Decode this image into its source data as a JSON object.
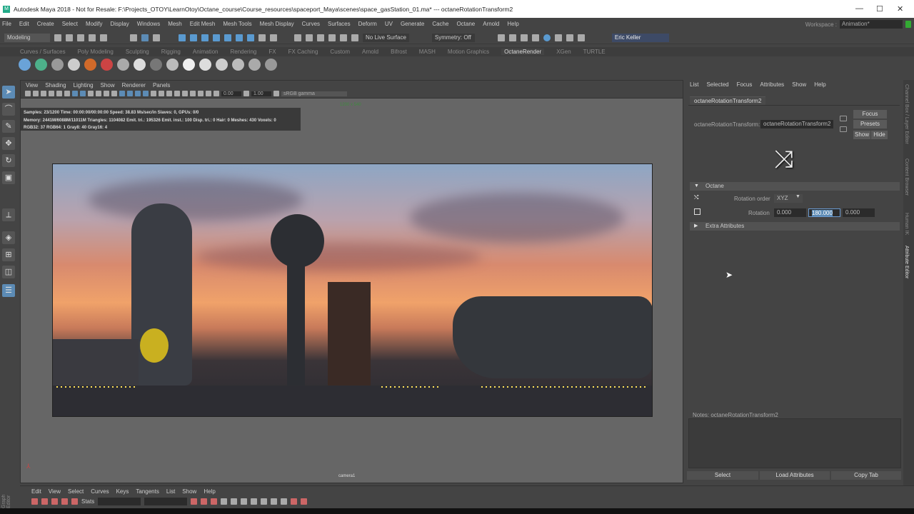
{
  "window": {
    "title": "Autodesk Maya 2018 - Not for Resale: F:\\Projects_OTOY\\LearnOtoy\\Octane_course\\Course_resources\\spaceport_Maya\\scenes\\space_gasStation_01.ma*  ---  octaneRotationTransform2",
    "minimize": "—",
    "maximize": "☐",
    "close": "✕"
  },
  "menubar": [
    "File",
    "Edit",
    "Create",
    "Select",
    "Modify",
    "Display",
    "Windows",
    "Mesh",
    "Edit Mesh",
    "Mesh Tools",
    "Mesh Display",
    "Curves",
    "Surfaces",
    "Deform",
    "UV",
    "Generate",
    "Cache",
    "Octane",
    "Arnold",
    "Help"
  ],
  "workspace": {
    "label": "Workspace :",
    "value": "Animation*"
  },
  "statusline": {
    "mode": "Modeling",
    "live_surface": "No Live Surface",
    "symmetry": "Symmetry: Off",
    "user": "Eric Keller"
  },
  "shelf_tabs": [
    "Curves / Surfaces",
    "Poly Modeling",
    "Sculpting",
    "Rigging",
    "Animation",
    "Rendering",
    "FX",
    "FX Caching",
    "Custom",
    "Arnold",
    "Bifrost",
    "MASH",
    "Motion Graphics",
    "OctaneRender",
    "XGen",
    "TURTLE"
  ],
  "shelf_active": "OctaneRender",
  "viewport": {
    "menu": [
      "View",
      "Shading",
      "Lighting",
      "Show",
      "Renderer",
      "Panels"
    ],
    "exposure": "0.00",
    "gamma": "1.00",
    "color_space": "sRGB gamma",
    "resolution": "1200 x 540",
    "stats": [
      "Samples: 23/1200 Time: 00:00:00/00:00:00 Speed: 38.83 Ms/sec/in Slaves: 0, GPUs: 0/0",
      "Memory: 2441M/6088M/11011M Triangles: 1104082 Emit. tri.: 195326 Emit. inst.: 100 Disp. tri.: 0 Hair: 0 Meshes: 430 Voxels: 0",
      "RGB32: 37 RGB64: 1 Gray8: 40 Gray16: 4"
    ],
    "camera": "camera1"
  },
  "attribute_editor": {
    "menu": [
      "List",
      "Selected",
      "Focus",
      "Attributes",
      "Show",
      "Help"
    ],
    "tab": "octaneRotationTransform2",
    "node_label": "octaneRotationTransform:",
    "node_value": "octaneRotationTransform2",
    "buttons": {
      "focus": "Focus",
      "presets": "Presets",
      "show": "Show",
      "hide": "Hide"
    },
    "section": "Octane",
    "rotation_order_label": "Rotation order",
    "rotation_order": "XYZ",
    "rotation_label": "Rotation",
    "rotation": [
      "0.000",
      "180.000",
      "0.000"
    ],
    "extra": "Extra Attributes",
    "notes_label": "Notes:  octaneRotationTransform2",
    "bottom_buttons": [
      "Select",
      "Load Attributes",
      "Copy Tab"
    ]
  },
  "side_tabs": [
    "Channel Box / Layer Editor",
    "Content Browser",
    "Human IK",
    "Attribute Editor"
  ],
  "graph_editor": {
    "menu": [
      "Edit",
      "View",
      "Select",
      "Curves",
      "Keys",
      "Tangents",
      "List",
      "Show",
      "Help"
    ],
    "stats": "Stats",
    "side_label": "Graph Editor"
  }
}
